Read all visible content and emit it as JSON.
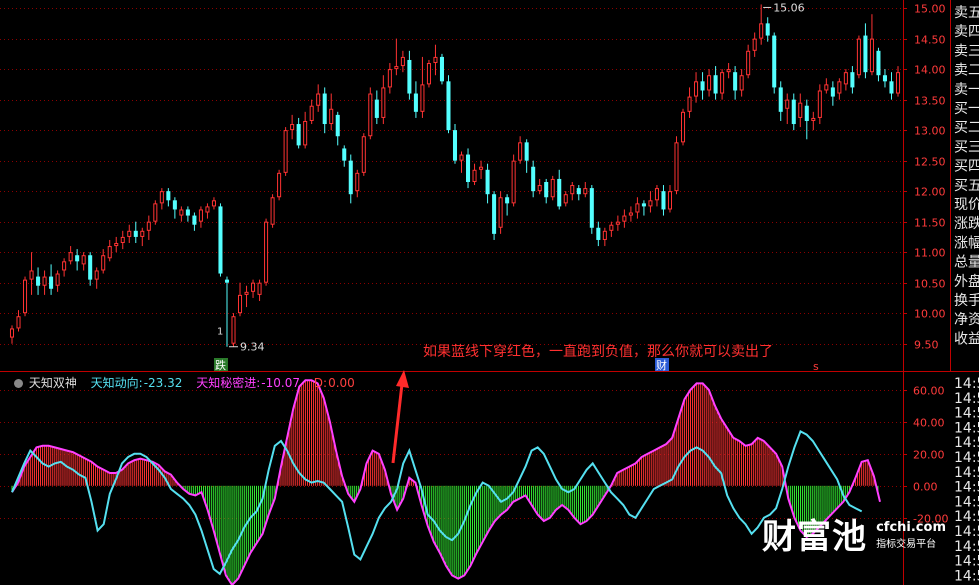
{
  "chart_data": [
    {
      "type": "candlestick",
      "ylim": [
        9.2,
        15.1
      ],
      "yticks": [
        "15.00",
        "14.50",
        "14.00",
        "13.50",
        "13.00",
        "12.50",
        "12.00",
        "11.50",
        "11.00",
        "10.50",
        "10.00",
        "9.50"
      ],
      "candles": [
        [
          9.6,
          9.75,
          9.5,
          9.8
        ],
        [
          9.75,
          9.95,
          9.7,
          10.05
        ],
        [
          10.0,
          10.55,
          9.95,
          10.6
        ],
        [
          10.55,
          10.7,
          10.3,
          11.0
        ],
        [
          10.6,
          10.45,
          10.3,
          10.75
        ],
        [
          10.45,
          10.6,
          10.3,
          10.7
        ],
        [
          10.6,
          10.4,
          10.3,
          10.8
        ],
        [
          10.45,
          10.65,
          10.35,
          10.7
        ],
        [
          10.7,
          10.85,
          10.6,
          10.9
        ],
        [
          10.85,
          11.0,
          10.8,
          11.1
        ],
        [
          10.95,
          10.85,
          10.7,
          11.05
        ],
        [
          10.8,
          10.95,
          10.7,
          11.0
        ],
        [
          10.95,
          10.55,
          10.45,
          11.0
        ],
        [
          10.55,
          10.7,
          10.4,
          10.75
        ],
        [
          10.7,
          10.95,
          10.65,
          11.05
        ],
        [
          10.9,
          11.1,
          10.85,
          11.2
        ],
        [
          11.1,
          11.15,
          11.0,
          11.25
        ],
        [
          11.15,
          11.25,
          11.05,
          11.35
        ],
        [
          11.25,
          11.35,
          11.15,
          11.45
        ],
        [
          11.35,
          11.25,
          11.15,
          11.5
        ],
        [
          11.25,
          11.35,
          11.1,
          11.4
        ],
        [
          11.35,
          11.5,
          11.2,
          11.6
        ],
        [
          11.5,
          11.8,
          11.45,
          11.85
        ],
        [
          11.8,
          12.0,
          11.7,
          12.05
        ],
        [
          12.0,
          11.85,
          11.75,
          12.05
        ],
        [
          11.85,
          11.7,
          11.55,
          11.9
        ],
        [
          11.6,
          11.7,
          11.5,
          11.75
        ],
        [
          11.7,
          11.6,
          11.5,
          11.75
        ],
        [
          11.6,
          11.45,
          11.35,
          11.65
        ],
        [
          11.5,
          11.7,
          11.4,
          11.75
        ],
        [
          11.65,
          11.75,
          11.55,
          11.8
        ],
        [
          11.75,
          11.85,
          11.7,
          11.9
        ],
        [
          11.75,
          10.65,
          10.6,
          11.8
        ],
        [
          10.55,
          10.5,
          9.45,
          10.6
        ],
        [
          9.5,
          9.95,
          9.45,
          10.0
        ],
        [
          10.0,
          10.3,
          9.95,
          10.5
        ],
        [
          10.3,
          10.35,
          10.1,
          10.45
        ],
        [
          10.35,
          10.5,
          10.25,
          10.55
        ],
        [
          10.3,
          10.5,
          10.2,
          10.55
        ],
        [
          10.5,
          11.5,
          10.45,
          11.55
        ],
        [
          11.45,
          11.9,
          11.4,
          11.95
        ],
        [
          11.9,
          12.3,
          11.85,
          12.35
        ],
        [
          12.3,
          13.0,
          12.25,
          13.05
        ],
        [
          13.0,
          13.1,
          12.85,
          13.25
        ],
        [
          13.1,
          12.75,
          12.7,
          13.2
        ],
        [
          12.75,
          13.15,
          12.7,
          13.3
        ],
        [
          13.15,
          13.4,
          13.1,
          13.5
        ],
        [
          13.4,
          13.6,
          13.3,
          13.75
        ],
        [
          13.6,
          13.1,
          12.95,
          13.7
        ],
        [
          13.1,
          13.35,
          13.0,
          13.6
        ],
        [
          13.25,
          12.9,
          12.75,
          13.3
        ],
        [
          12.7,
          12.5,
          12.4,
          12.75
        ],
        [
          12.5,
          11.95,
          11.8,
          12.6
        ],
        [
          12.0,
          12.3,
          11.9,
          12.35
        ],
        [
          12.3,
          12.9,
          12.25,
          12.95
        ],
        [
          12.9,
          13.6,
          12.85,
          13.7
        ],
        [
          13.5,
          13.2,
          13.1,
          13.65
        ],
        [
          13.2,
          13.7,
          13.1,
          13.9
        ],
        [
          13.7,
          14.0,
          13.6,
          14.1
        ],
        [
          14.0,
          14.05,
          13.9,
          14.5
        ],
        [
          14.05,
          14.2,
          13.95,
          14.3
        ],
        [
          14.15,
          13.6,
          13.5,
          14.3
        ],
        [
          13.6,
          13.3,
          13.2,
          13.8
        ],
        [
          13.3,
          13.75,
          13.2,
          14.2
        ],
        [
          13.75,
          14.1,
          13.7,
          14.15
        ],
        [
          14.1,
          14.2,
          13.9,
          14.4
        ],
        [
          14.2,
          13.8,
          13.75,
          14.25
        ],
        [
          13.8,
          13.0,
          12.95,
          13.9
        ],
        [
          13.0,
          12.5,
          12.45,
          13.1
        ],
        [
          12.5,
          12.6,
          12.3,
          12.65
        ],
        [
          12.6,
          12.15,
          12.05,
          12.7
        ],
        [
          12.15,
          12.35,
          12.1,
          12.45
        ],
        [
          12.35,
          12.4,
          12.2,
          12.5
        ],
        [
          12.35,
          11.95,
          11.8,
          12.45
        ],
        [
          11.95,
          11.3,
          11.2,
          12.0
        ],
        [
          11.4,
          11.9,
          11.3,
          12.0
        ],
        [
          11.9,
          11.8,
          11.6,
          11.95
        ],
        [
          11.8,
          12.5,
          11.75,
          12.6
        ],
        [
          12.5,
          12.8,
          12.45,
          12.9
        ],
        [
          12.8,
          12.5,
          12.3,
          12.85
        ],
        [
          12.4,
          12.0,
          11.9,
          12.5
        ],
        [
          12.0,
          12.1,
          11.95,
          12.2
        ],
        [
          12.15,
          11.9,
          11.8,
          12.2
        ],
        [
          11.9,
          12.2,
          11.85,
          12.25
        ],
        [
          12.2,
          11.75,
          11.7,
          12.35
        ],
        [
          11.8,
          11.95,
          11.75,
          12.0
        ],
        [
          11.95,
          12.1,
          11.85,
          12.15
        ],
        [
          12.05,
          11.95,
          11.85,
          12.1
        ],
        [
          11.95,
          12.05,
          11.9,
          12.15
        ],
        [
          12.05,
          11.4,
          11.3,
          12.1
        ],
        [
          11.4,
          11.2,
          11.1,
          11.5
        ],
        [
          11.2,
          11.35,
          11.1,
          11.4
        ],
        [
          11.35,
          11.45,
          11.25,
          11.5
        ],
        [
          11.45,
          11.5,
          11.35,
          11.6
        ],
        [
          11.5,
          11.6,
          11.4,
          11.7
        ],
        [
          11.6,
          11.65,
          11.5,
          11.75
        ],
        [
          11.65,
          11.8,
          11.55,
          11.9
        ],
        [
          11.8,
          11.75,
          11.6,
          11.85
        ],
        [
          11.75,
          11.85,
          11.65,
          12.0
        ],
        [
          11.85,
          12.05,
          11.75,
          12.1
        ],
        [
          12.0,
          11.7,
          11.6,
          12.1
        ],
        [
          11.7,
          12.0,
          11.65,
          12.1
        ],
        [
          12.0,
          12.8,
          11.95,
          12.9
        ],
        [
          12.8,
          13.3,
          12.75,
          13.35
        ],
        [
          13.3,
          13.55,
          13.2,
          13.7
        ],
        [
          13.55,
          13.8,
          13.45,
          13.95
        ],
        [
          13.8,
          13.65,
          13.5,
          13.95
        ],
        [
          13.65,
          13.9,
          13.55,
          14.0
        ],
        [
          13.9,
          13.6,
          13.5,
          14.05
        ],
        [
          13.6,
          13.95,
          13.5,
          14.0
        ],
        [
          13.95,
          14.0,
          13.85,
          14.1
        ],
        [
          13.95,
          13.65,
          13.5,
          14.05
        ],
        [
          13.65,
          13.9,
          13.55,
          14.0
        ],
        [
          13.9,
          14.3,
          13.85,
          14.4
        ],
        [
          14.3,
          14.5,
          14.2,
          14.6
        ],
        [
          14.5,
          14.75,
          14.4,
          15.06
        ],
        [
          14.75,
          14.55,
          14.45,
          14.85
        ],
        [
          14.55,
          13.7,
          13.6,
          14.6
        ],
        [
          13.7,
          13.3,
          13.15,
          13.8
        ],
        [
          13.35,
          13.5,
          13.1,
          13.6
        ],
        [
          13.5,
          13.1,
          13.0,
          13.6
        ],
        [
          13.2,
          13.45,
          13.05,
          13.6
        ],
        [
          13.4,
          13.15,
          12.85,
          13.5
        ],
        [
          13.15,
          13.2,
          13.0,
          13.3
        ],
        [
          13.2,
          13.65,
          13.1,
          13.75
        ],
        [
          13.65,
          13.75,
          13.6,
          13.85
        ],
        [
          13.7,
          13.55,
          13.4,
          13.8
        ],
        [
          13.6,
          13.8,
          13.5,
          13.85
        ],
        [
          13.75,
          13.95,
          13.65,
          14.0
        ],
        [
          13.95,
          13.7,
          13.6,
          14.05
        ],
        [
          13.9,
          14.5,
          13.85,
          14.55
        ],
        [
          14.55,
          13.95,
          13.85,
          14.75
        ],
        [
          13.95,
          14.5,
          13.9,
          14.9
        ],
        [
          14.3,
          13.9,
          13.8,
          14.35
        ],
        [
          13.9,
          13.8,
          13.7,
          14.0
        ],
        [
          13.8,
          13.6,
          13.5,
          13.95
        ],
        [
          13.6,
          13.95,
          13.55,
          14.05
        ]
      ],
      "annotations": {
        "high_label": "15.06",
        "low_label": "9.34",
        "low_marker": "1",
        "flag_die": "跌",
        "flag_cai": "财",
        "flag_s": "s",
        "note": "如果蓝线下穿红色，一直跑到负值，那么你就可以卖出了"
      }
    },
    {
      "type": "indicator",
      "title": "天知双神",
      "ylim": [
        -62,
        68
      ],
      "yticks": [
        "60.00",
        "40.00",
        "20.00",
        "0.00",
        "-20.00"
      ],
      "series": [
        {
          "name": "天知动向",
          "value_label": "-23.32",
          "color": "#55e0f0"
        },
        {
          "name": "天知秘密进",
          "value_label": "-10.07",
          "color": "#ff40ff"
        },
        {
          "name": "D",
          "value_label": "0.00",
          "color": "#ff4040"
        }
      ],
      "red": [
        -4,
        2,
        12,
        18,
        24,
        25,
        25,
        24,
        23,
        22,
        21,
        19,
        17,
        15,
        12,
        10,
        8,
        8,
        10,
        14,
        16,
        17,
        16,
        15,
        13,
        9,
        7,
        2,
        -2,
        -5,
        -6,
        -4,
        -15,
        -28,
        -42,
        -56,
        -62,
        -58,
        -50,
        -42,
        -36,
        -30,
        -18,
        -8,
        12,
        30,
        48,
        62,
        66,
        66,
        64,
        55,
        40,
        22,
        6,
        -5,
        -10,
        -2,
        14,
        22,
        20,
        10,
        -5,
        -15,
        -8,
        5,
        2,
        -12,
        -25,
        -35,
        -42,
        -50,
        -56,
        -58,
        -56,
        -50,
        -42,
        -35,
        -28,
        -22,
        -18,
        -15,
        -10,
        -8,
        -6,
        -12,
        -18,
        -22,
        -20,
        -15,
        -12,
        -15,
        -20,
        -24,
        -22,
        -18,
        -12,
        -6,
        0,
        8,
        10,
        12,
        14,
        18,
        20,
        22,
        24,
        26,
        30,
        42,
        54,
        60,
        64,
        64,
        60,
        50,
        42,
        36,
        30,
        28,
        25,
        26,
        30,
        28,
        24,
        20,
        12,
        -8,
        -20,
        -28,
        -32,
        -30,
        -26,
        -22,
        -18,
        -14,
        -10,
        -4,
        5,
        15,
        16,
        6,
        -10
      ],
      "cyan": [
        -4,
        5,
        14,
        22,
        18,
        14,
        12,
        14,
        15,
        12,
        10,
        7,
        5,
        -10,
        -28,
        -24,
        -5,
        4,
        14,
        18,
        20,
        20,
        18,
        14,
        10,
        5,
        -2,
        -5,
        -8,
        -12,
        -18,
        -28,
        -40,
        -52,
        -55,
        -48,
        -40,
        -34,
        -26,
        -20,
        -16,
        -8,
        10,
        25,
        28,
        22,
        14,
        8,
        4,
        2,
        3,
        2,
        -2,
        -6,
        -10,
        -26,
        -43,
        -46,
        -38,
        -30,
        -20,
        -14,
        -10,
        -2,
        14,
        22,
        10,
        -2,
        -18,
        -22,
        -28,
        -32,
        -34,
        -30,
        -22,
        -12,
        -4,
        2,
        0,
        -5,
        -10,
        -8,
        -4,
        4,
        12,
        22,
        24,
        20,
        12,
        4,
        -2,
        -4,
        -2,
        4,
        10,
        14,
        8,
        2,
        -4,
        -8,
        -12,
        -18,
        -20,
        -14,
        -8,
        -2,
        0,
        2,
        4,
        12,
        18,
        22,
        24,
        22,
        18,
        12,
        8,
        -6,
        -14,
        -20,
        -24,
        -30,
        -26,
        -20,
        -18,
        -14,
        -2,
        12,
        24,
        34,
        32,
        28,
        22,
        16,
        10,
        4,
        -6,
        -12,
        -14,
        -16
      ]
    }
  ],
  "side_panel": {
    "labels": [
      "卖五",
      "卖四",
      "卖三",
      "卖二",
      "卖一",
      "买一",
      "买二",
      "买三",
      "买四",
      "买五",
      "现价",
      "涨跌",
      "涨幅",
      "总量",
      "外盘",
      "换手",
      "净资",
      "收益"
    ],
    "times": [
      "14:5",
      "14:5",
      "14:5",
      "14:5",
      "14:5",
      "14:5",
      "14:5",
      "14:5",
      "14:5",
      "14:5",
      "14:5",
      "14:5",
      "14:5",
      "14:5"
    ]
  },
  "legend": {
    "title": "天知双神",
    "s1_name": "天知动向:",
    "s1_val": "-23.32",
    "s2_name": "天知秘密进:",
    "s2_val": "-10.07",
    "s3_name": "D:",
    "s3_val": "0.00"
  },
  "watermark": {
    "brand": "财富池",
    "site": "cfchi.com",
    "tagline": "指标交易平台"
  },
  "colors": {
    "up": "#ff3333",
    "down": "#54ffff",
    "grid": "#8b0000",
    "axis": "#c00000",
    "cyan_line": "#55e0f0",
    "magenta_line": "#ff40ff",
    "green_bar": "#33ee33",
    "red_bar": "#ff3333",
    "annotation": "#ff3030"
  }
}
